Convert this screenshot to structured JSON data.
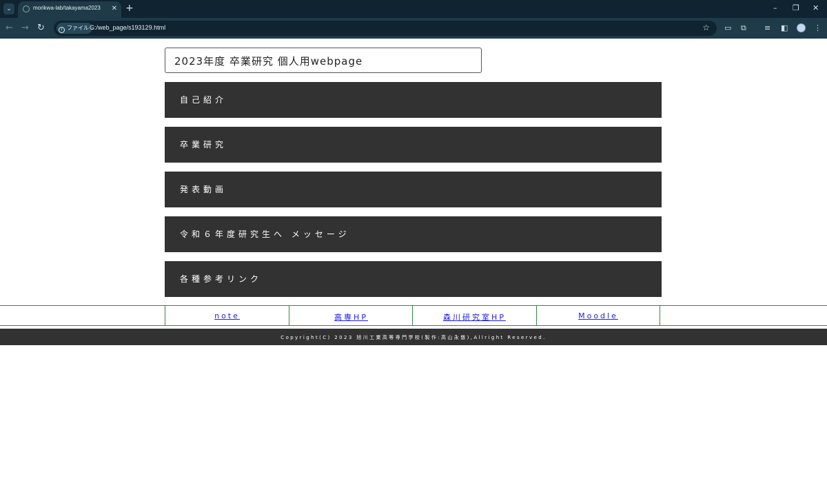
{
  "browser": {
    "tab_title": "morikwa-lab/takayama2023",
    "tab_close": "✕",
    "new_tab": "+",
    "info_chip": "ファイル",
    "url": "G:/web_page/s193129.html"
  },
  "page": {
    "title": "2023年度 卒業研究 個人用webpage",
    "menu": [
      {
        "label": "自己紹介"
      },
      {
        "label": "卒業研究"
      },
      {
        "label": "発表動画"
      },
      {
        "label": "令和６年度研究生へ メッセージ"
      },
      {
        "label": "各種参考リンク"
      }
    ],
    "links": [
      {
        "label": "note"
      },
      {
        "label": "高専HP"
      },
      {
        "label": "森川研究室HP"
      },
      {
        "label": "Moodle"
      }
    ],
    "footer": "Copyright(C) 2023 旭川工業高等専門学校(製作:高山永慈),Allright Reserved."
  },
  "colors": {
    "menu_bg": "#323232",
    "link_color": "#1a1aee",
    "link_border": "#2f8a3a",
    "chrome_dark": "#0f2430",
    "chrome_toolbar": "#1f3a48"
  }
}
